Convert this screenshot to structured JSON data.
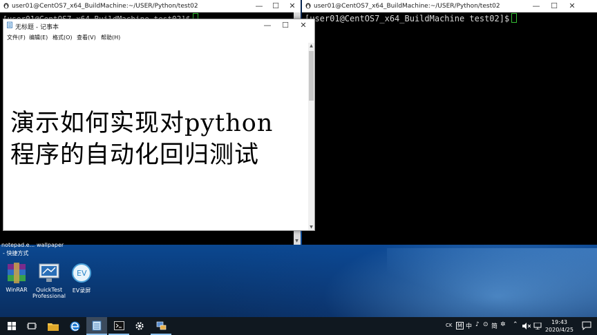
{
  "terminal_left": {
    "title": "user01@CentOS7_x64_BuildMachine:~/USER/Python/test02",
    "prompt": "[user01@CentOS7_x64_BuildMachine test02]$"
  },
  "terminal_right": {
    "title": "user01@CentOS7_x64_BuildMachine:~/USER/Python/test02",
    "prompt": "[user01@CentOS7_x64_BuildMachine test02]$"
  },
  "window_controls": {
    "minimize": "—",
    "maximize": "☐",
    "close": "✕"
  },
  "notepad": {
    "title": "无标题 - 记事本",
    "menu": [
      "文件(F)",
      "编辑(E)",
      "格式(O)",
      "查看(V)",
      "帮助(H)"
    ],
    "text_lines": [
      "演示如何实现对python",
      "程序的自动化回归测试"
    ]
  },
  "desktop_icons": [
    {
      "label": "WinRAR",
      "icon": "winrar-icon"
    },
    {
      "label": "QuickTest Professional",
      "icon": "quicktest-icon"
    },
    {
      "label": "EV录屏",
      "icon": "ev-recorder-icon"
    }
  ],
  "partial_labels": {
    "notepad_shortcut": "notepad.e...",
    "shortcut_suffix": "- 快捷方式",
    "wallpaper": "wallpaper"
  },
  "taskbar": {
    "items": [
      "start-icon",
      "task-view-icon",
      "file-explorer-icon",
      "edge-icon",
      "notepad-icon",
      "terminal-icon",
      "settings-icon",
      "network-app-icon"
    ],
    "tray": {
      "ime1": "CK",
      "ime2": "M",
      "ime3": "中",
      "ime4": "♪",
      "ime5": "⊙",
      "ime6": "简",
      "ime7": "✲"
    },
    "time": "19:43",
    "date": "2020/4/25"
  }
}
